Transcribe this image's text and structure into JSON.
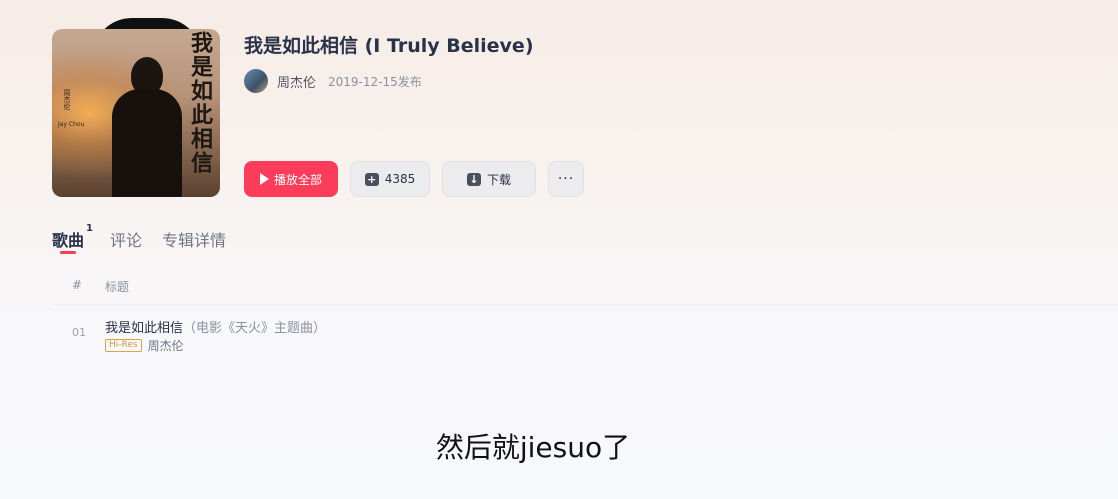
{
  "album": {
    "title": "我是如此相信 (I Truly Believe)",
    "cover_title": "我是如此相信",
    "cover_artist_cn": "周杰伦",
    "cover_artist_en": "Jay Chou",
    "artist": "周杰伦",
    "date": "2019-12-15发布"
  },
  "actions": {
    "play_all": "播放全部",
    "collect_count": "4385",
    "download": "下载",
    "more": "···"
  },
  "tabs": [
    {
      "label": "歌曲",
      "count": "1",
      "active": true
    },
    {
      "label": "评论"
    },
    {
      "label": "专辑详情"
    }
  ],
  "table": {
    "header_index": "#",
    "header_title": "标题",
    "rows": [
      {
        "index": "01",
        "title": "我是如此相信",
        "subtitle": "（电影《天火》主题曲）",
        "badge": "Hi-Res",
        "artist": "周杰伦"
      }
    ]
  },
  "caption": "然后就jiesuo了",
  "colors": {
    "accent": "#fc3d5a",
    "text": "#283248",
    "hires": "#d49a32"
  }
}
